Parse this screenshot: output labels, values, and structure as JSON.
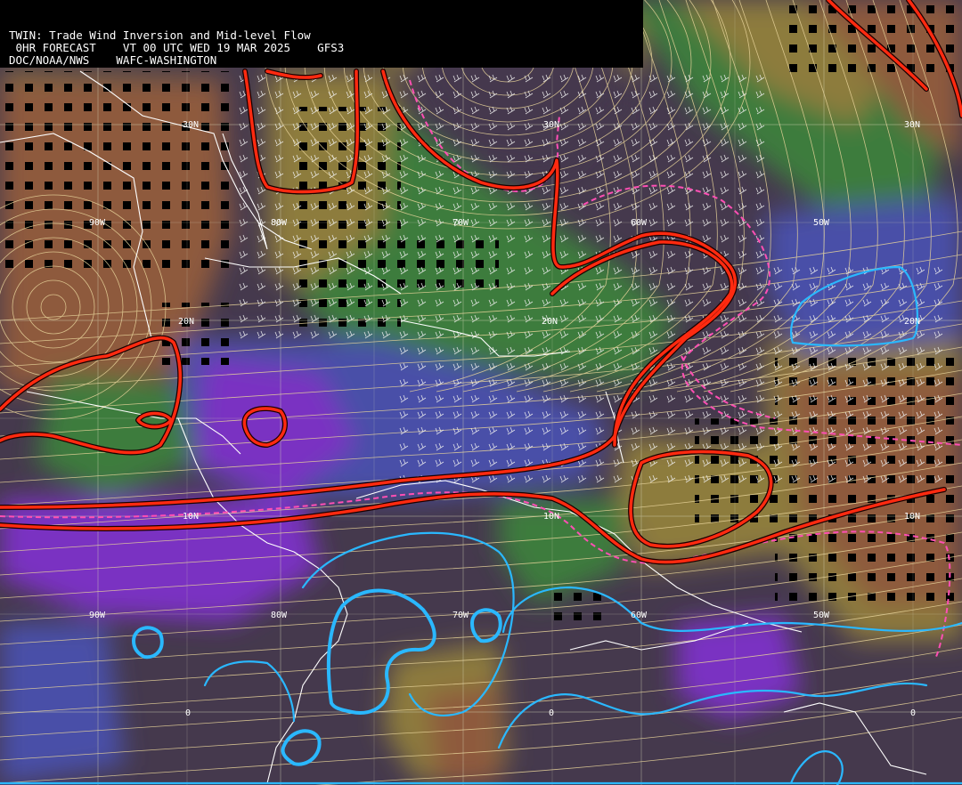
{
  "header": {
    "line1": "TWIN: Trade Wind Inversion and Mid-level Flow",
    "line2": " 0HR FORECAST    VT 00 UTC WED 19 MAR 2025    GFS3",
    "line3": "DOC/NOAA/NWS    WAFC-WASHINGTON"
  },
  "grid_labels": {
    "lat_30n": "30N",
    "lat_20n": "20N",
    "lat_10n": "10N",
    "lon_90w": "90W",
    "lon_80w": "80W",
    "lon_70w": "70W",
    "lon_60w": "60W",
    "lon_50w": "50W",
    "equator": "0"
  },
  "colors": {
    "inversion_contour": "#ff2a10",
    "humid_contour": "#2ab8ff",
    "dashed_contour": "#ff4fb4",
    "streamlines": "#e8d49a",
    "wind_barbs": "#f0f0f0",
    "coastline": "#ffffff",
    "graticule": "#d8d8b8",
    "field_dark": "#45394d",
    "field_purple": "#7a33c2",
    "field_blue": "#4a50a8",
    "field_green": "#3e7b3e",
    "field_olive": "#8d7c3c",
    "field_brown": "#8e5a3c"
  }
}
